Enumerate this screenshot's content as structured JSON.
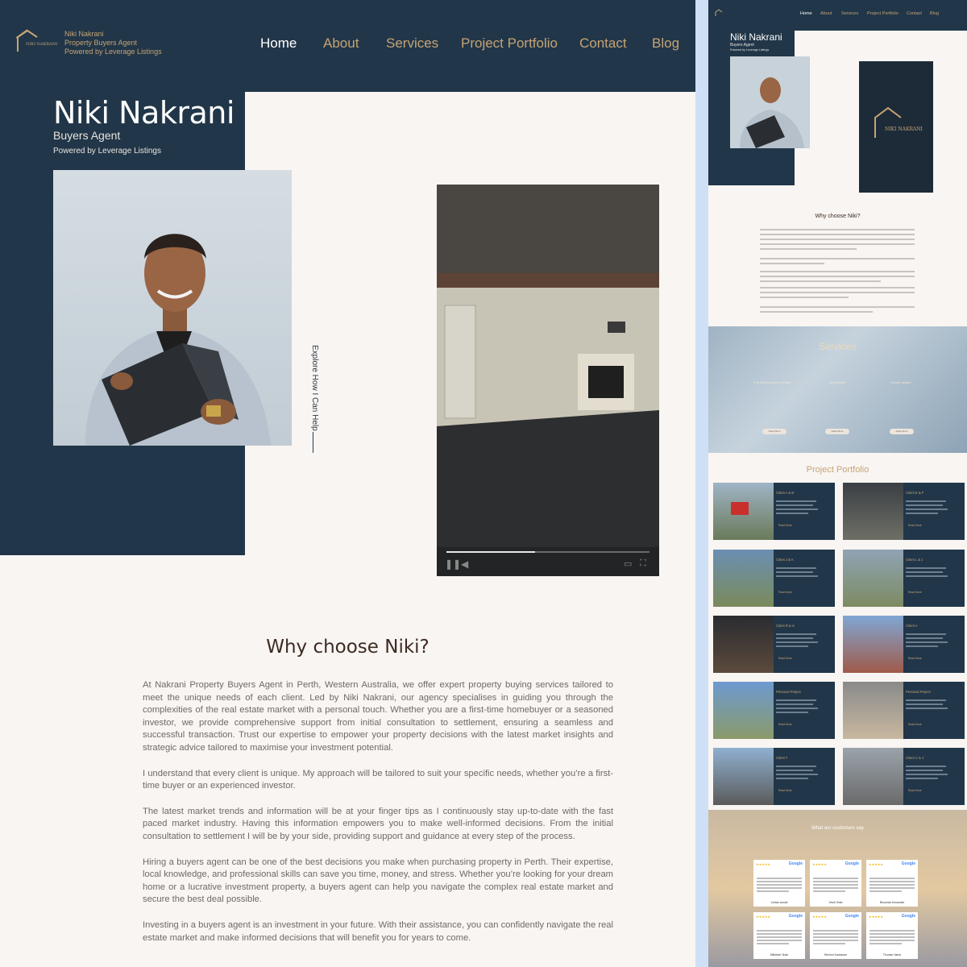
{
  "brand": {
    "name_line": "NIKI NAKRANI",
    "line1": "Niki Nakrani",
    "line2": "Property Buyers Agent",
    "line3": "Powered by Leverage Listings"
  },
  "nav": [
    "Home",
    "About",
    "Services",
    "Project Portfolio",
    "Contact",
    "Blog"
  ],
  "hero": {
    "name": "Niki Nakrani",
    "role": "Buyers Agent",
    "powered": "Powered by Leverage Listings",
    "explore": "Explore How I Can Help"
  },
  "why": {
    "title": "Why choose Niki?",
    "paragraphs": [
      "At Nakrani Property Buyers Agent in Perth, Western Australia, we offer expert property buying services tailored to meet the unique needs of each client. Led by Niki Nakrani, our agency specialises in guiding you through the complexities of the real estate market with a personal touch. Whether you are a first-time homebuyer or a seasoned investor, we provide comprehensive support from initial consultation to settlement, ensuring a seamless and successful transaction. Trust our expertise to empower your property decisions with the latest market insights and strategic advice tailored to maximise your investment potential.",
      "I understand that every client is unique. My approach will be tailored to suit your specific needs, whether you’re a first-time buyer or an experienced investor.",
      "The latest market trends and information will be at your finger tips as I continuously stay up-to-date with the fast paced market industry. Having this information empowers you to make well-informed decisions. From the initial consultation to settlement I will be by your side, providing support and guidance at every step of the process.",
      "Hiring a buyers agent can be one of the best decisions you make when purchasing property in Perth. Their expertise, local knowledge, and professional skills can save you time, money, and stress. Whether you’re looking for your dream home or a lucrative investment property, a buyers agent can help you navigate the complex real estate market and secure the best deal possible.",
      "Investing in a buyers agent is an investment in your future. With their assistance, you can confidently navigate the  real estate market and make informed decisions that will benefit you for years to come."
    ]
  },
  "preview": {
    "nav": [
      "Home",
      "About",
      "Services",
      "Project Portfolio",
      "Contact",
      "Blog"
    ],
    "name": "Niki Nakrani",
    "role": "Buyers Agent",
    "powered": "Powered by Leverage Listings",
    "why_title": "Why choose Niki?",
    "services_title": "Services",
    "services": [
      "Full Buyers Agent Service",
      "Negotiation",
      "Vendor Advice"
    ],
    "read_more": "Read More",
    "portfolio_title": "Project Portfolio",
    "cards": [
      "Client A & B",
      "Client E & F",
      "Client J & K",
      "Client L & J",
      "Client R & S",
      "Client A",
      "Personal Project",
      "Personal Project",
      "Client T",
      "Client C & J"
    ],
    "card_read_more": "Read More",
    "testimonials_title": "What our customers say",
    "google": "Google",
    "stars": "★★★★★",
    "reviewers": [
      "Jordan arnold",
      "Vivek Shah",
      "Bhoomee fernandes",
      "Mithilesh Shah",
      "Reshmi Sundaram",
      "Thomas Harris"
    ]
  },
  "colors": {
    "navy": "#213649",
    "gold": "#c6a474",
    "cream": "#f8f5f2"
  }
}
